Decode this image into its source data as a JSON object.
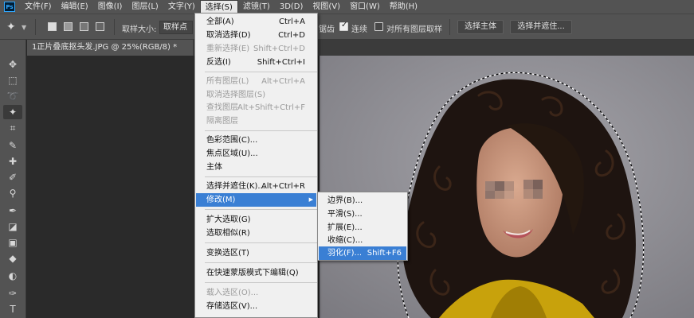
{
  "menubar": {
    "logo": "Ps",
    "items": [
      "文件(F)",
      "编辑(E)",
      "图像(I)",
      "图层(L)",
      "文字(Y)",
      "选择(S)",
      "滤镜(T)",
      "3D(D)",
      "视图(V)",
      "窗口(W)",
      "帮助(H)"
    ],
    "active_index": 5
  },
  "options_bar": {
    "tool_icon": "magic-wand-icon",
    "sample_size_label": "取样大小:",
    "sample_size_value": "取样点",
    "partial_label": "锯齿",
    "contiguous_label": "连续",
    "contiguous_checked": true,
    "all_layers_label": "对所有图层取样",
    "all_layers_checked": false,
    "select_subject_label": "选择主体",
    "select_and_mask_label": "选择并遮住..."
  },
  "toolbar": {
    "tools": [
      "move-icon",
      "marquee-icon",
      "lasso-icon",
      "magic-wand-icon",
      "crop-icon",
      "eyedropper-icon",
      "healing-brush-icon",
      "brush-icon",
      "clone-stamp-icon",
      "history-brush-icon",
      "eraser-icon",
      "gradient-icon",
      "blur-icon"
    ],
    "active_index": 3
  },
  "document_tab": {
    "title": "1正片叠底抠头发.JPG @ 25%(RGB/8) *",
    "close": "×"
  },
  "select_menu": [
    {
      "label": "全部(A)",
      "shortcut": "Ctrl+A",
      "disabled": false
    },
    {
      "label": "取消选择(D)",
      "shortcut": "Ctrl+D",
      "disabled": false
    },
    {
      "label": "重新选择(E)",
      "shortcut": "Shift+Ctrl+D",
      "disabled": true
    },
    {
      "label": "反选(I)",
      "shortcut": "Shift+Ctrl+I",
      "disabled": false
    },
    {
      "label": "所有图层(L)",
      "shortcut": "Alt+Ctrl+A",
      "disabled": true
    },
    {
      "label": "取消选择图层(S)",
      "shortcut": "",
      "disabled": true
    },
    {
      "label": "查找图层",
      "shortcut": "Alt+Shift+Ctrl+F",
      "disabled": true
    },
    {
      "label": "隔离图层",
      "shortcut": "",
      "disabled": true
    },
    {
      "label": "色彩范围(C)...",
      "shortcut": "",
      "disabled": false
    },
    {
      "label": "焦点区域(U)...",
      "shortcut": "",
      "disabled": false
    },
    {
      "label": "主体",
      "shortcut": "",
      "disabled": false
    },
    {
      "label": "选择并遮住(K)...",
      "shortcut": "Alt+Ctrl+R",
      "disabled": false
    },
    {
      "label": "修改(M)",
      "shortcut": "",
      "disabled": false,
      "submenu": true,
      "highlighted": true
    },
    {
      "label": "扩大选取(G)",
      "shortcut": "",
      "disabled": false
    },
    {
      "label": "选取相似(R)",
      "shortcut": "",
      "disabled": false
    },
    {
      "label": "变换选区(T)",
      "shortcut": "",
      "disabled": false
    },
    {
      "label": "在快速蒙版模式下编辑(Q)",
      "shortcut": "",
      "disabled": false
    },
    {
      "label": "载入选区(O)...",
      "shortcut": "",
      "disabled": true
    },
    {
      "label": "存储选区(V)...",
      "shortcut": "",
      "disabled": false
    }
  ],
  "modify_submenu": [
    {
      "label": "边界(B)...",
      "shortcut": ""
    },
    {
      "label": "平滑(S)...",
      "shortcut": ""
    },
    {
      "label": "扩展(E)...",
      "shortcut": ""
    },
    {
      "label": "收缩(C)...",
      "shortcut": ""
    },
    {
      "label": "羽化(F)...",
      "shortcut": "Shift+F6",
      "highlighted": true
    }
  ],
  "colors": {
    "highlight": "#3a7fd4",
    "panel": "#535353",
    "backdrop": "#8e8d93",
    "hair": "#1e1410",
    "skin": "#c99479",
    "jacket": "#c8a20c"
  }
}
